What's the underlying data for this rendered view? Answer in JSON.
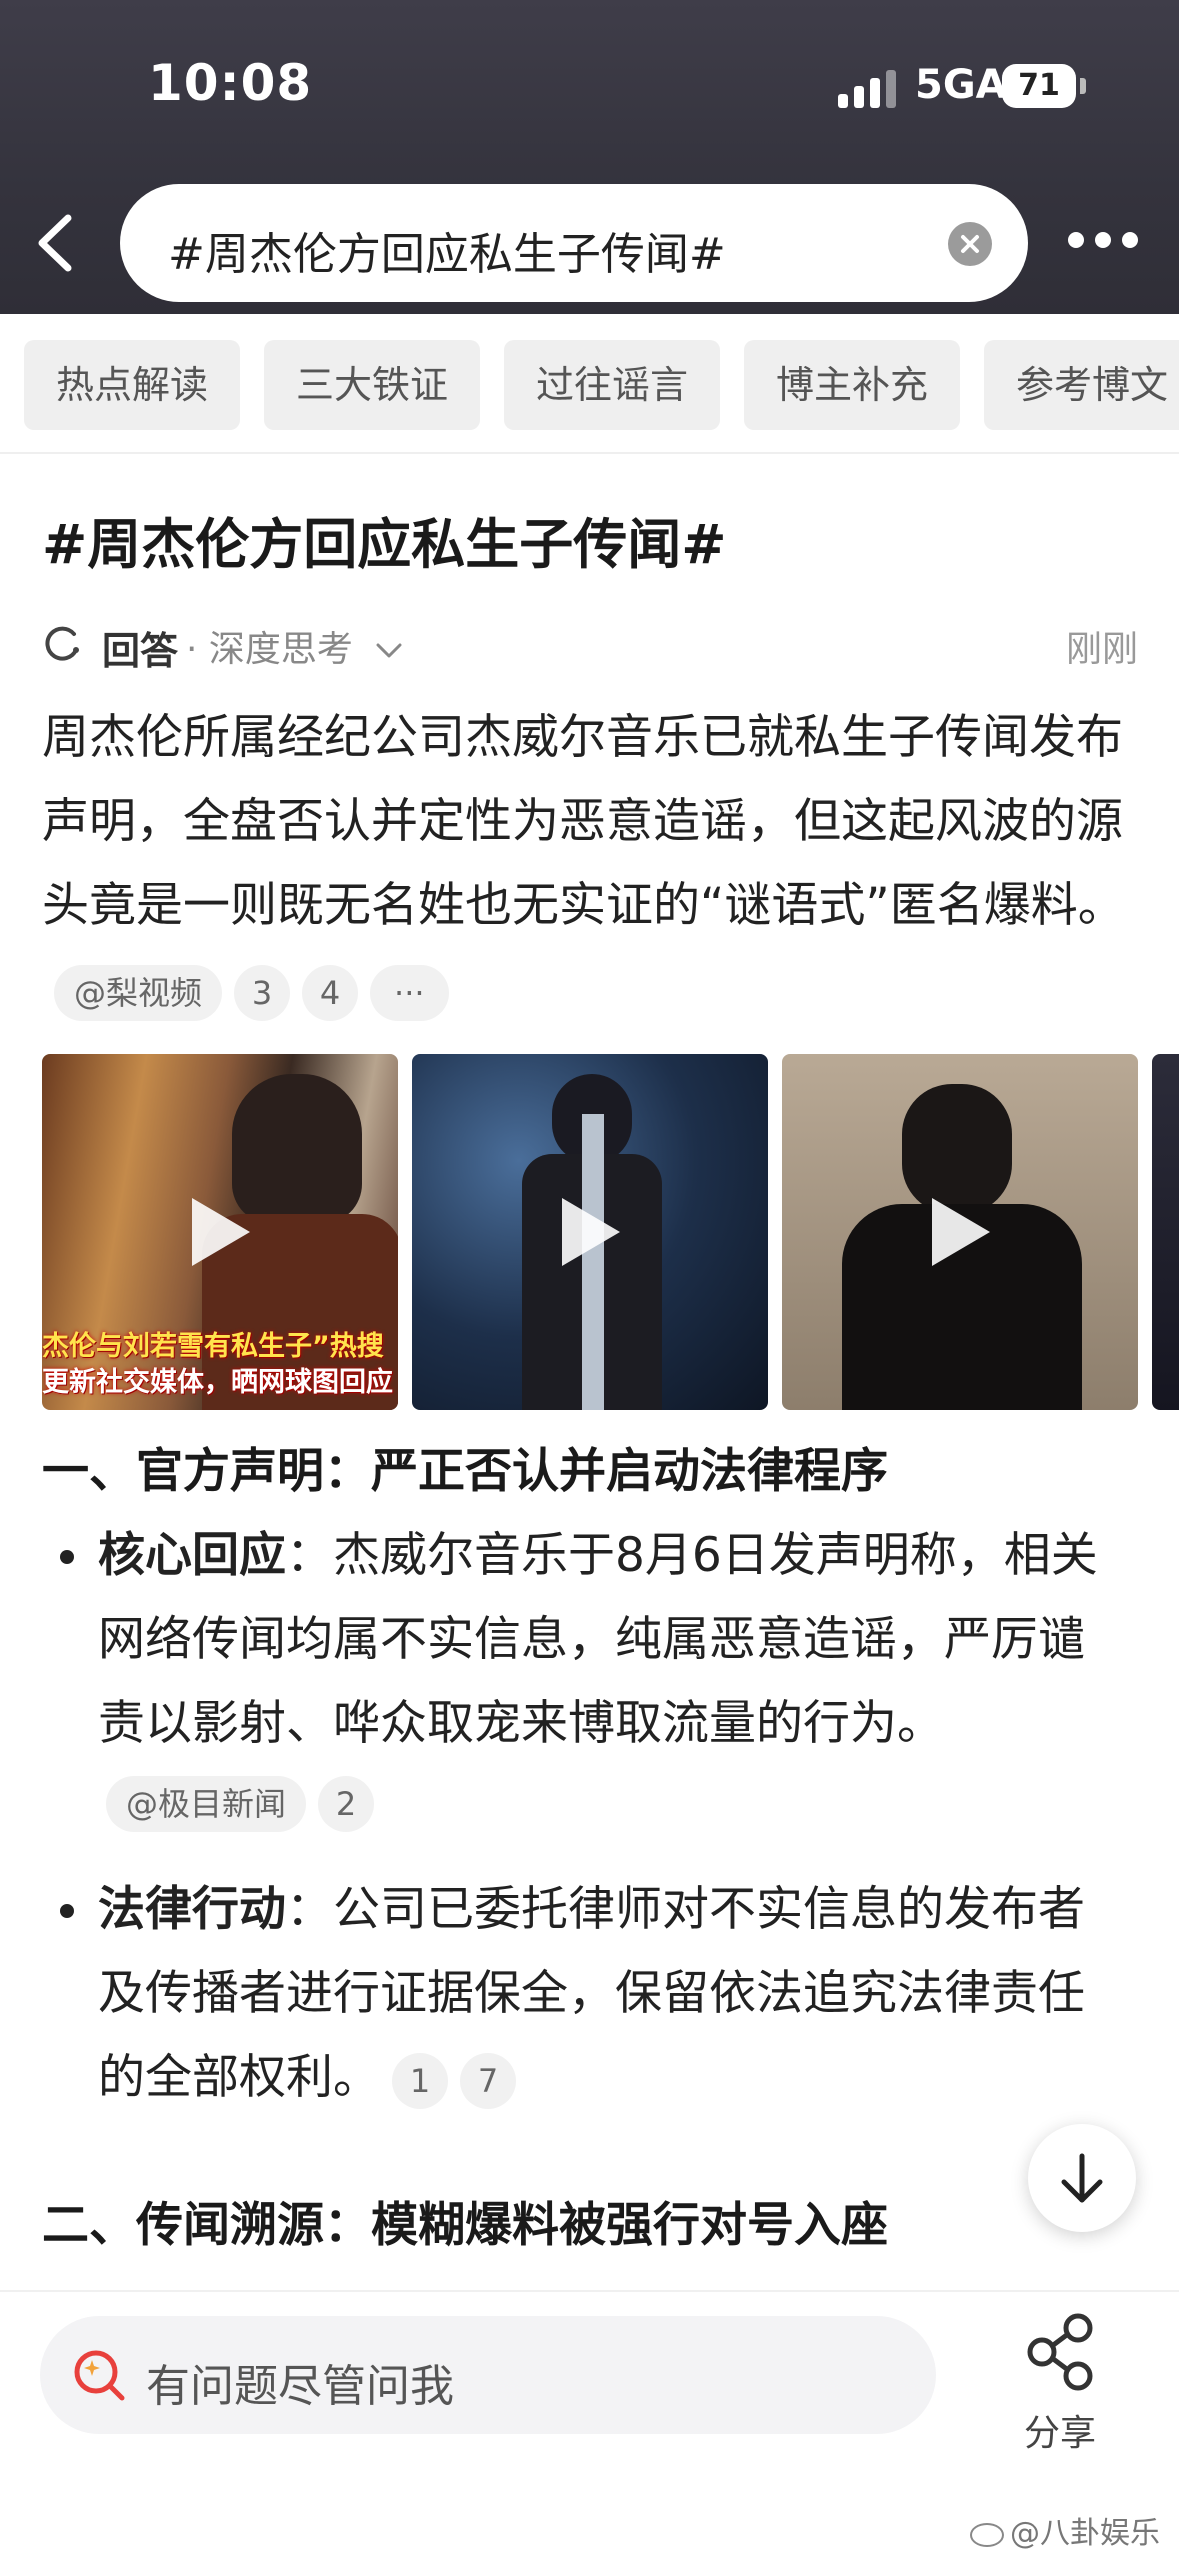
{
  "status": {
    "time": "10:08",
    "network": "5GA",
    "battery": "71",
    "battery_level_percent": 71
  },
  "search": {
    "query": "#周杰伦方回应私生子传闻#"
  },
  "tabs": [
    "热点解读",
    "三大铁证",
    "过往谣言",
    "博主补充",
    "参考博文"
  ],
  "content": {
    "title": "#周杰伦方回应私生子传闻#",
    "answer": {
      "label": "回答",
      "mode": "· 深度思考",
      "time": "刚刚"
    },
    "intro": "周杰伦所属经纪公司杰威尔音乐已就私生子传闻发布声明，全盘否认并定性为恶意造谣，但这起风波的源头竟是一则既无名姓也无实证的“谜语式”匿名爆料。",
    "intro_chips": {
      "source": "@梨视频",
      "ref1": "3",
      "ref2": "4",
      "more": "···"
    },
    "video_captions": {
      "line1": "杰伦与刘若雪有私生子”热搜",
      "line2": "更新社交媒体，晒网球图回应"
    },
    "section1": {
      "heading": "一、官方声明：严正否认并启动法律程序",
      "item1": {
        "label": "核心回应",
        "text": "：杰威尔音乐于8月6日发声明称，相关网络传闻均属不实信息，纯属恶意造谣，严厉谴责以影射、哗众取宠来博取流量的行为。",
        "source": "@极目新闻",
        "ref": "2"
      },
      "item2": {
        "label": "法律行动",
        "text": "：公司已委托律师对不实信息的发布者及传播者进行证据保全，保留依法追究法律责任的全部权利。",
        "ref1": "1",
        "ref2": "7"
      }
    },
    "section2": {
      "heading": "二、传闻溯源：模糊爆料被强行对号入座"
    }
  },
  "bottom": {
    "ask_placeholder": "有问题尽管问我",
    "share_label": "分享"
  },
  "watermark": "@八卦娱乐",
  "colors": {
    "header_bg": "#3a3944",
    "accent_red": "#e8403c",
    "chip_bg": "#f1f1f1"
  }
}
